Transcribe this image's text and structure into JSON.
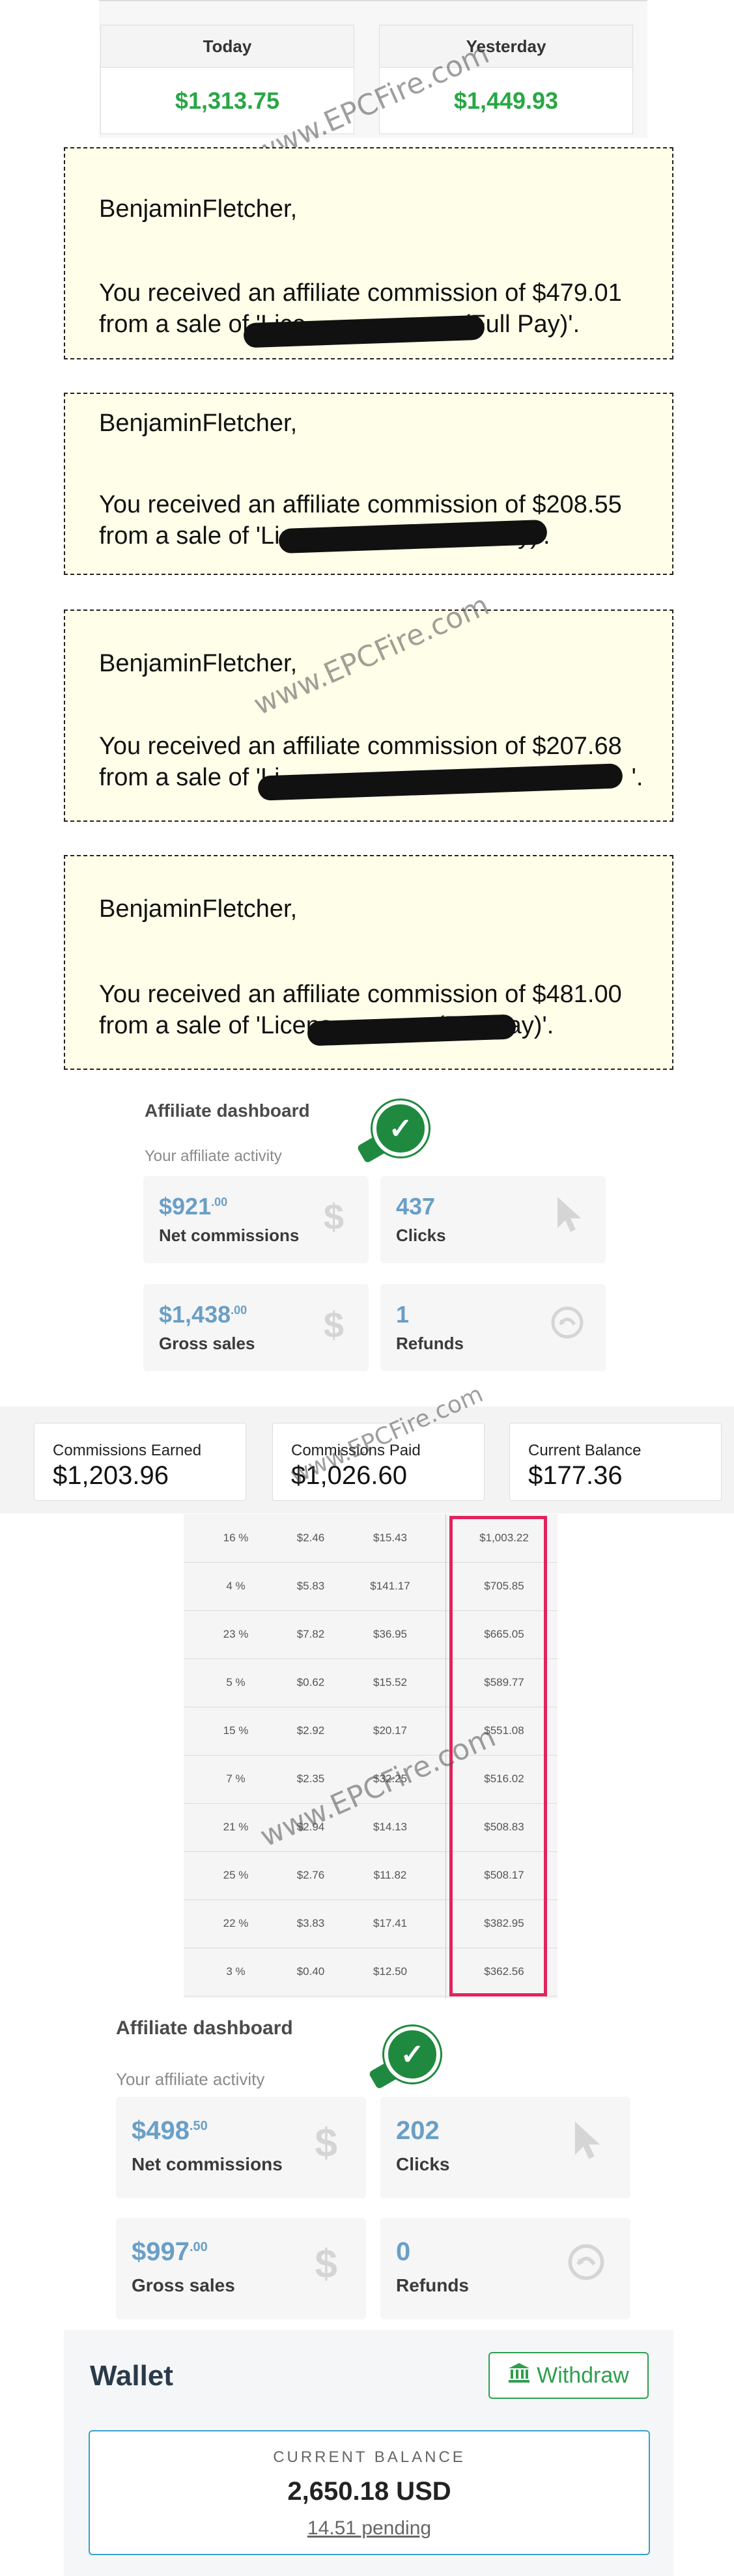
{
  "earnings": {
    "today_label": "Today",
    "today_value": "$1,313.75",
    "yesterday_label": "Yesterday",
    "yesterday_value": "$1,449.93"
  },
  "watermark": "www.EPCFire.com",
  "notices": [
    {
      "recipient": "BenjaminFletcher,",
      "line1": "You received an affiliate commission of $479.01",
      "line2": "from a sale of 'Lice",
      "line2_tail": "(Full Pay)'."
    },
    {
      "recipient": "BenjaminFletcher,",
      "line1": "You received an affiliate commission of $208.55",
      "line2": "from a sale of 'Lic",
      "line2_tail": "Pay)'."
    },
    {
      "recipient": "BenjaminFletcher,",
      "line1": "You received an affiliate commission of $207.68",
      "line2": "from a sale of 'Li",
      "line2_tail": "'."
    },
    {
      "recipient": "BenjaminFletcher,",
      "line1": "You received an affiliate commission of $481.00",
      "line2": "from a sale of 'Licens",
      "line2_tail": "(Full Pay)'."
    }
  ],
  "dashboard1": {
    "title": "Affiliate dashboard",
    "subtitle": "Your affiliate activity",
    "net_commissions": {
      "value": "$921",
      "cents": ".00",
      "label": "Net commissions"
    },
    "clicks": {
      "value": "437",
      "label": "Clicks"
    },
    "gross_sales": {
      "value": "$1,438",
      "cents": ".00",
      "label": "Gross sales"
    },
    "refunds": {
      "value": "1",
      "label": "Refunds"
    }
  },
  "commission_summary": {
    "earned_label": "Commissions Earned",
    "earned_value": "$1,203.96",
    "paid_label": "Commissions Paid",
    "paid_value": "$1,026.60",
    "balance_label": "Current Balance",
    "balance_value": "$177.36"
  },
  "table": {
    "rows": [
      [
        "16 %",
        "$2.46",
        "$15.43",
        "$1,003.22"
      ],
      [
        "4 %",
        "$5.83",
        "$141.17",
        "$705.85"
      ],
      [
        "23 %",
        "$7.82",
        "$36.95",
        "$665.05"
      ],
      [
        "5 %",
        "$0.62",
        "$15.52",
        "$589.77"
      ],
      [
        "15 %",
        "$2.92",
        "$20.17",
        "$551.08"
      ],
      [
        "7 %",
        "$2.35",
        "$32.25",
        "$516.02"
      ],
      [
        "21 %",
        "$2.94",
        "$14.13",
        "$508.83"
      ],
      [
        "25 %",
        "$2.76",
        "$11.82",
        "$508.17"
      ],
      [
        "22 %",
        "$3.83",
        "$17.41",
        "$382.95"
      ],
      [
        "3 %",
        "$0.40",
        "$12.50",
        "$362.56"
      ]
    ]
  },
  "dashboard2": {
    "title": "Affiliate dashboard",
    "subtitle": "Your affiliate activity",
    "net_commissions": {
      "value": "$498",
      "cents": ".50",
      "label": "Net commissions"
    },
    "clicks": {
      "value": "202",
      "label": "Clicks"
    },
    "gross_sales": {
      "value": "$997",
      "cents": ".00",
      "label": "Gross sales"
    },
    "refunds": {
      "value": "0",
      "label": "Refunds"
    }
  },
  "wallet": {
    "title": "Wallet",
    "withdraw_label": "Withdraw",
    "balance_label": "CURRENT BALANCE",
    "balance_value": "2,650.18 USD",
    "pending": "14.51 pending"
  },
  "icons": {
    "check": "check-icon",
    "dollar": "dollar-icon",
    "cursor": "cursor-icon",
    "refund": "refund-icon",
    "bank": "bank-icon"
  },
  "colors": {
    "green": "#28a745",
    "stat_blue": "#6a9fc6",
    "highlight": "#e0245e",
    "notice_bg": "#ffffe9"
  }
}
